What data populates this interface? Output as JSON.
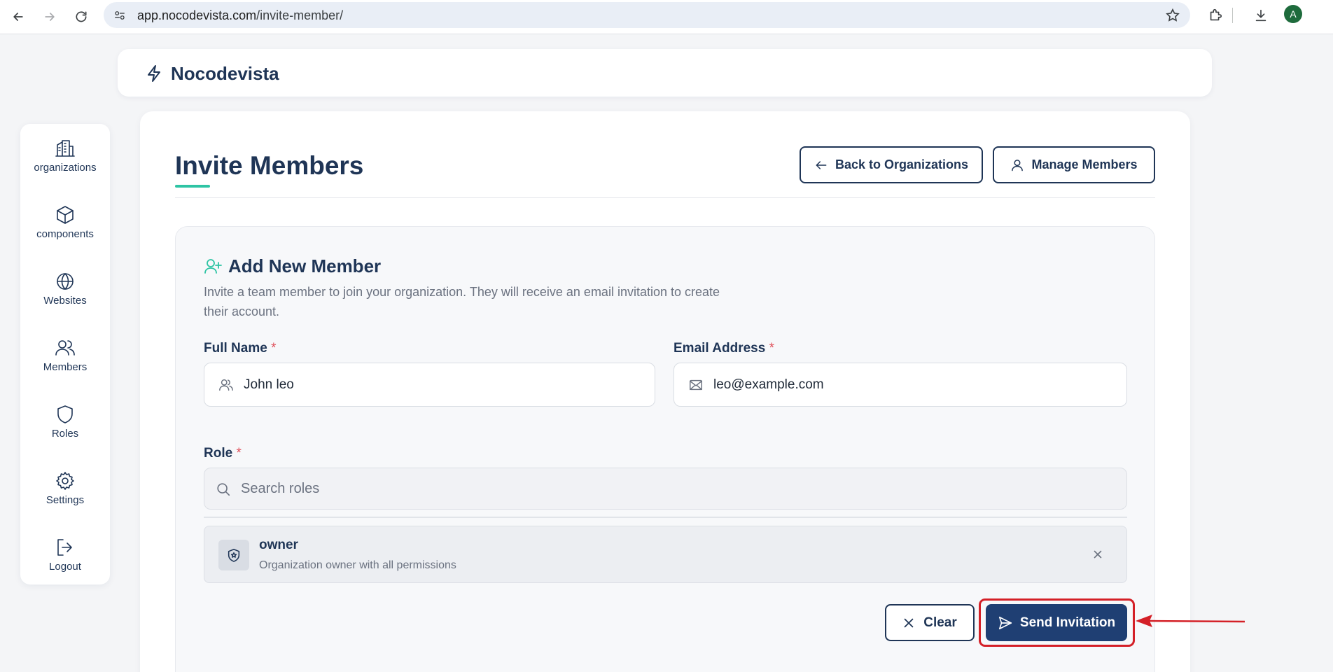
{
  "browser": {
    "url_host": "app.nocodevista.com",
    "url_path": "/invite-member/",
    "profile_initial": "A"
  },
  "brand": {
    "name": "Nocodevista",
    "icon": "lightning-bolt-icon"
  },
  "sidebar": {
    "items": [
      {
        "label": "organizations",
        "icon": "building-icon"
      },
      {
        "label": "components",
        "icon": "cube-icon"
      },
      {
        "label": "Websites",
        "icon": "globe-icon"
      },
      {
        "label": "Members",
        "icon": "users-icon"
      },
      {
        "label": "Roles",
        "icon": "shield-icon"
      },
      {
        "label": "Settings",
        "icon": "gear-icon"
      },
      {
        "label": "Logout",
        "icon": "logout-icon"
      }
    ]
  },
  "page": {
    "title": "Invite Members",
    "back_button": "Back to Organizations",
    "manage_button": "Manage Members"
  },
  "form": {
    "section_title": "Add New Member",
    "description": "Invite a team member to join your organization. They will receive an email invitation to create their account.",
    "full_name_label": "Full Name",
    "full_name_value": "John leo",
    "email_label": "Email Address",
    "email_value": "leo@example.com",
    "required_mark": "*",
    "role_label": "Role",
    "role_search_placeholder": "Search roles",
    "selected_role": {
      "name": "owner",
      "description": "Organization owner with all permissions"
    },
    "clear_button": "Clear",
    "send_button": "Send Invitation"
  },
  "colors": {
    "primary": "#1f3f73",
    "accent": "#2ec4a4",
    "required": "#e0505a",
    "annotation": "#d42027"
  }
}
